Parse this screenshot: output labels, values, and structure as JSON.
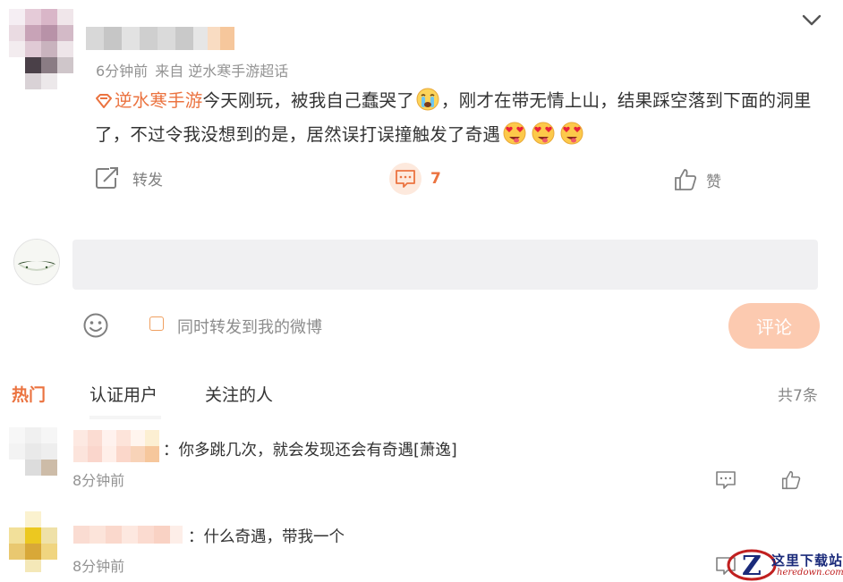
{
  "post": {
    "meta_time": "6分钟前",
    "meta_source": "来自 逆水寒手游超话",
    "topic": "逆水寒手游",
    "text_part1": "今天刚玩，被我自己蠢哭了",
    "text_part2": "，刚才在带无情上山，结果踩空落到下面的洞里了，不过令我没想到的是，居然误打误撞触发了奇遇",
    "emojis": [
      "crying-emoji",
      "heart-eyes-emoji"
    ]
  },
  "actions": {
    "repost_label": "转发",
    "comment_count": "7",
    "like_label": "赞"
  },
  "composer": {
    "input_placeholder": "",
    "forward_label": "同时转发到我的微博",
    "submit_label": "评论"
  },
  "tabs": {
    "hot": "热门",
    "verified": "认证用户",
    "following": "关注的人",
    "total": "共7条"
  },
  "comments": [
    {
      "text": "：你多跳几次，就会发现还会有奇遇[萧逸]",
      "time": "8分钟前"
    },
    {
      "text": "：什么奇遇，带我一个",
      "time": "8分钟前"
    }
  ],
  "watermark": {
    "text": "这里下载站",
    "sub": "heredown.com"
  },
  "colors": {
    "accent": "#eb7340",
    "submit_bg": "#fccab0",
    "input_bg": "#f0f0f2",
    "muted": "#939393"
  }
}
